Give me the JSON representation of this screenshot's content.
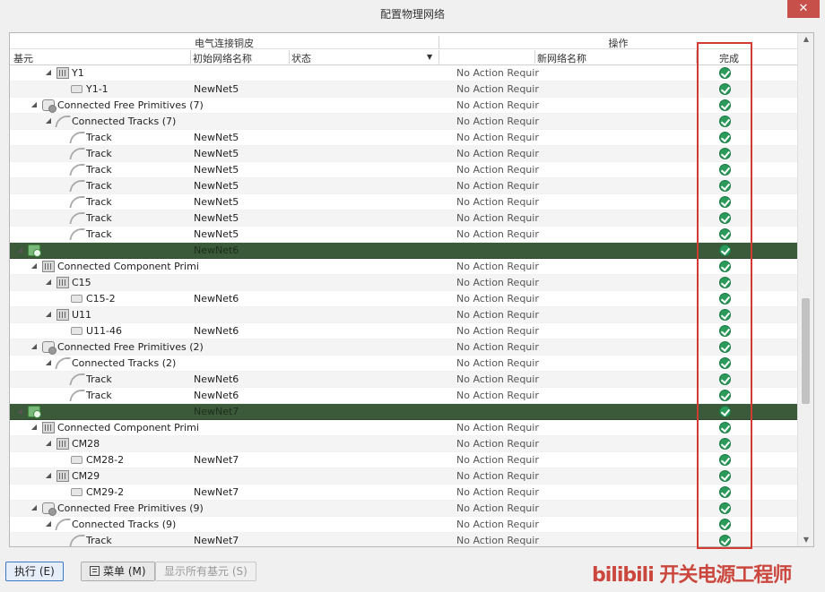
{
  "window": {
    "title": "配置物理网络",
    "close_label": "✕"
  },
  "grid": {
    "group_headers": [
      "电气连接铜皮",
      "操作"
    ],
    "columns": {
      "primitive": "基元",
      "initial_net": "初始网络名称",
      "status": "状态",
      "new_net": "新网络名称",
      "done": "完成"
    },
    "rows": [
      {
        "indent": 2,
        "toggle": "◢",
        "icon": "component",
        "label": "Y1",
        "net": "",
        "action": "No Action Requir",
        "done": true
      },
      {
        "indent": 3,
        "toggle": "",
        "icon": "pad",
        "label": "Y1-1",
        "net": "NewNet5",
        "action": "No Action Requir",
        "done": true
      },
      {
        "indent": 1,
        "toggle": "◢",
        "icon": "free-primitive",
        "label": "Connected Free Primitives (7)",
        "net": "",
        "action": "No Action Requir",
        "done": true
      },
      {
        "indent": 2,
        "toggle": "◢",
        "icon": "track",
        "label": "Connected Tracks (7)",
        "net": "",
        "action": "No Action Requir",
        "done": true
      },
      {
        "indent": 3,
        "toggle": "",
        "icon": "track",
        "label": "Track",
        "net": "NewNet5",
        "action": "No Action Requir",
        "done": true
      },
      {
        "indent": 3,
        "toggle": "",
        "icon": "track",
        "label": "Track",
        "net": "NewNet5",
        "action": "No Action Requir",
        "done": true
      },
      {
        "indent": 3,
        "toggle": "",
        "icon": "track",
        "label": "Track",
        "net": "NewNet5",
        "action": "No Action Requir",
        "done": true
      },
      {
        "indent": 3,
        "toggle": "",
        "icon": "track",
        "label": "Track",
        "net": "NewNet5",
        "action": "No Action Requir",
        "done": true
      },
      {
        "indent": 3,
        "toggle": "",
        "icon": "track",
        "label": "Track",
        "net": "NewNet5",
        "action": "No Action Requir",
        "done": true
      },
      {
        "indent": 3,
        "toggle": "",
        "icon": "track",
        "label": "Track",
        "net": "NewNet5",
        "action": "No Action Requir",
        "done": true
      },
      {
        "indent": 3,
        "toggle": "",
        "icon": "track",
        "label": "Track",
        "net": "NewNet5",
        "action": "No Action Requir",
        "done": true
      },
      {
        "indent": 0,
        "toggle": "◢",
        "icon": "net",
        "label": "",
        "net": "NewNet6",
        "action": "",
        "done": true,
        "group": true
      },
      {
        "indent": 1,
        "toggle": "◢",
        "icon": "component",
        "label": "Connected Component Primi",
        "net": "",
        "action": "No Action Requir",
        "done": true
      },
      {
        "indent": 2,
        "toggle": "◢",
        "icon": "component",
        "label": "C15",
        "net": "",
        "action": "No Action Requir",
        "done": true
      },
      {
        "indent": 3,
        "toggle": "",
        "icon": "pad",
        "label": "C15-2",
        "net": "NewNet6",
        "action": "No Action Requir",
        "done": true
      },
      {
        "indent": 2,
        "toggle": "◢",
        "icon": "component",
        "label": "U11",
        "net": "",
        "action": "No Action Requir",
        "done": true
      },
      {
        "indent": 3,
        "toggle": "",
        "icon": "pad",
        "label": "U11-46",
        "net": "NewNet6",
        "action": "No Action Requir",
        "done": true
      },
      {
        "indent": 1,
        "toggle": "◢",
        "icon": "free-primitive",
        "label": "Connected Free Primitives (2)",
        "net": "",
        "action": "No Action Requir",
        "done": true
      },
      {
        "indent": 2,
        "toggle": "◢",
        "icon": "track",
        "label": "Connected Tracks (2)",
        "net": "",
        "action": "No Action Requir",
        "done": true
      },
      {
        "indent": 3,
        "toggle": "",
        "icon": "track",
        "label": "Track",
        "net": "NewNet6",
        "action": "No Action Requir",
        "done": true
      },
      {
        "indent": 3,
        "toggle": "",
        "icon": "track",
        "label": "Track",
        "net": "NewNet6",
        "action": "No Action Requir",
        "done": true
      },
      {
        "indent": 0,
        "toggle": "◢",
        "icon": "net",
        "label": "",
        "net": "NewNet7",
        "action": "",
        "done": true,
        "group": true
      },
      {
        "indent": 1,
        "toggle": "◢",
        "icon": "component",
        "label": "Connected Component Primi",
        "net": "",
        "action": "No Action Requir",
        "done": true
      },
      {
        "indent": 2,
        "toggle": "◢",
        "icon": "component",
        "label": "CM28",
        "net": "",
        "action": "No Action Requir",
        "done": true
      },
      {
        "indent": 3,
        "toggle": "",
        "icon": "pad",
        "label": "CM28-2",
        "net": "NewNet7",
        "action": "No Action Requir",
        "done": true
      },
      {
        "indent": 2,
        "toggle": "◢",
        "icon": "component",
        "label": "CM29",
        "net": "",
        "action": "No Action Requir",
        "done": true
      },
      {
        "indent": 3,
        "toggle": "",
        "icon": "pad",
        "label": "CM29-2",
        "net": "NewNet7",
        "action": "No Action Requir",
        "done": true
      },
      {
        "indent": 1,
        "toggle": "◢",
        "icon": "free-primitive",
        "label": "Connected Free Primitives (9)",
        "net": "",
        "action": "No Action Requir",
        "done": true
      },
      {
        "indent": 2,
        "toggle": "◢",
        "icon": "track",
        "label": "Connected Tracks (9)",
        "net": "",
        "action": "No Action Requir",
        "done": true
      },
      {
        "indent": 3,
        "toggle": "",
        "icon": "track",
        "label": "Track",
        "net": "NewNet7",
        "action": "No Action Requir",
        "done": true
      }
    ]
  },
  "scrollbar": {
    "up_arrow": "▲",
    "down_arrow": "▼"
  },
  "footer": {
    "execute_label": "执行 (E)",
    "menu_label": "菜单 (M)",
    "show_all_label": "显示所有基元 (S)"
  },
  "watermark": {
    "text": "bilibili 开关电源工程师"
  },
  "colors": {
    "group_row": "#3a5a3a",
    "done_check": "#2b9a5a",
    "highlight_box": "#d23a32",
    "primary_button_border": "#3a78c8"
  }
}
